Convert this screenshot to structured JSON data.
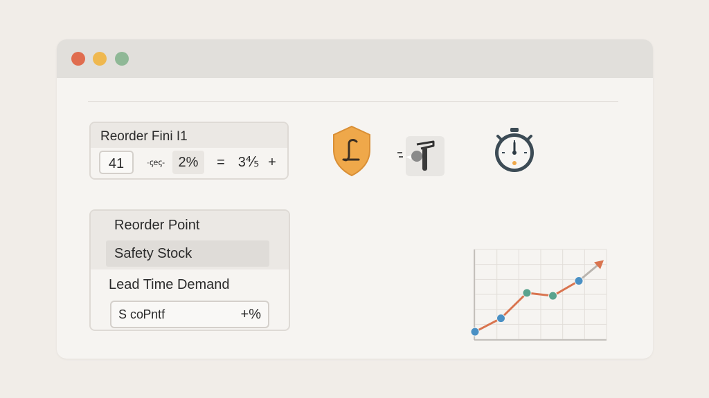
{
  "colors": {
    "background": "#f1ede8",
    "window": "#f6f4f1",
    "titlebar": "#e1dfdb",
    "close_dot": "#e06d4f",
    "minimize_dot": "#efb84f",
    "maximize_dot": "#8fb896",
    "shield": "#efa84a",
    "line": "#d9744f",
    "point_green": "#5aa38e",
    "point_blue": "#4a90c4"
  },
  "window_controls": [
    "close",
    "minimize",
    "maximize"
  ],
  "formula": {
    "title": "Reorder Fini I1",
    "quantity": "41",
    "operator_text": "·ꞔeꞔ-",
    "percent": "2%",
    "equals": "=",
    "result": "3⅘",
    "plus": "+"
  },
  "toolbar": {
    "icons": [
      "shield-icon",
      "tool-icon",
      "stopwatch-icon"
    ]
  },
  "list": {
    "items": [
      {
        "label": "Reorder Point"
      },
      {
        "label": "Safety Stock"
      },
      {
        "label": "Lead Time Demand"
      }
    ],
    "input_label": "S coᏢntf",
    "input_suffix": "+%"
  },
  "chart_data": {
    "type": "line",
    "x": [
      1,
      2,
      3,
      4,
      5
    ],
    "values": [
      1.0,
      1.9,
      3.6,
      3.4,
      4.4
    ],
    "trend_arrow": true,
    "grid": true,
    "ylim": [
      0.5,
      6.5
    ]
  }
}
